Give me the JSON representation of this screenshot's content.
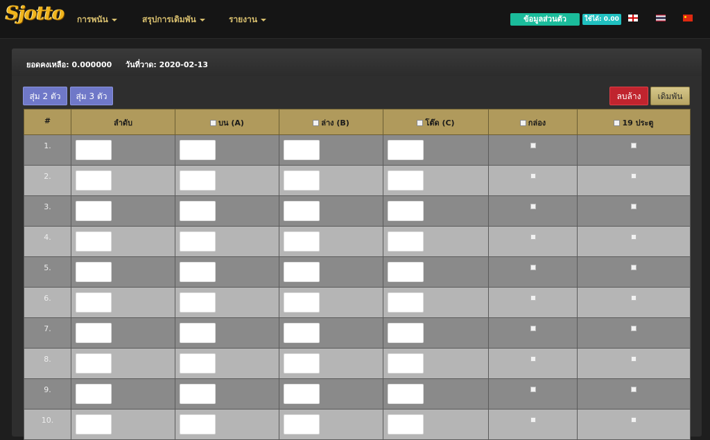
{
  "brand": {
    "logo_text": "Sjotto"
  },
  "nav": {
    "menu": [
      "การพนัน",
      "สรุปการเดิมพัน",
      "รายงาน"
    ],
    "profile_label": "ข้อมูลส่วนตัว",
    "credit_label": "ใช้ได้: 0.00"
  },
  "info": {
    "balance_label": "ยอดคงเหลือ:",
    "balance_value": "0.000000",
    "draw_date_label": "วันที่วาด:",
    "draw_date_value": "2020-02-13"
  },
  "actions": {
    "random2_label": "สุ่ม 2 ตัว",
    "random3_label": "สุ่ม 3 ตัว",
    "clear_label": "ลบล้าง",
    "bet_label": "เดิมพัน"
  },
  "table": {
    "headers": {
      "num": "#",
      "sequence": "ลำดับ",
      "top": "บน (A)",
      "bottom": "ล่าง (B)",
      "tod": "โต๊ด (C)",
      "box": "กล่อง",
      "door19": "19 ประตู"
    },
    "rows": [
      "1.",
      "2.",
      "3.",
      "4.",
      "5.",
      "6.",
      "7.",
      "8.",
      "9.",
      "10."
    ]
  },
  "colors": {
    "header_bg": "#b09a5c",
    "profile_btn": "#1bbc9b",
    "random_btn": "#6f78c8",
    "clear_btn": "#c0242e",
    "row_dark": "#8a8a8a",
    "row_light": "#b5b5b5"
  }
}
